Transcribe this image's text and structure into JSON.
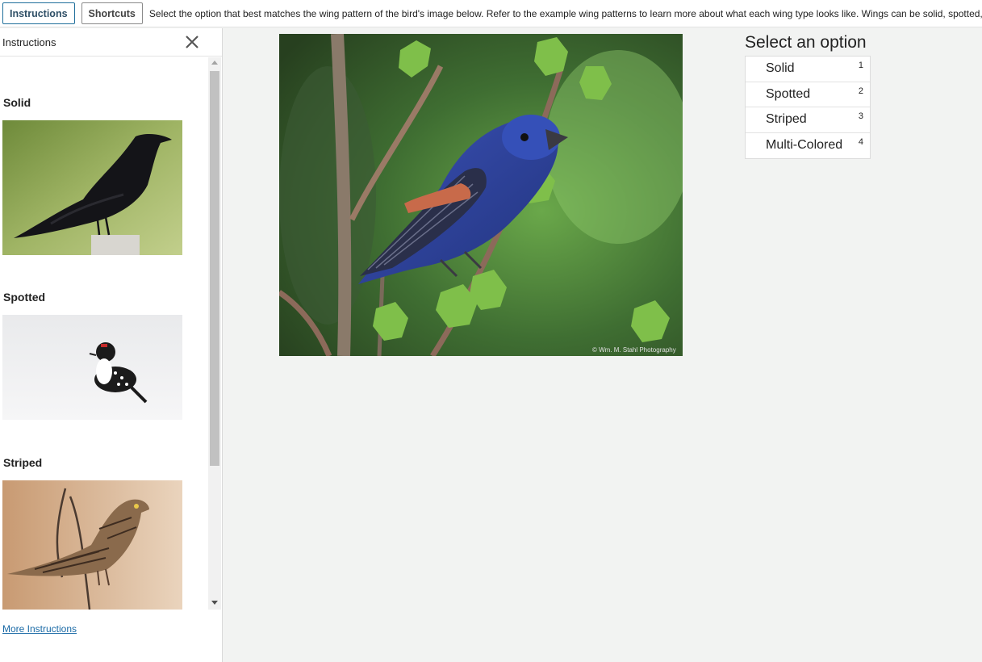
{
  "topbar": {
    "instructions_button": "Instructions",
    "shortcuts_button": "Shortcuts",
    "instruction_text": "Select the option that best matches the wing pattern of the bird's image below. Refer to the example wing patterns to learn more about what each wing type looks like. Wings can be solid, spotted, striped, or multi-colored."
  },
  "sidebar": {
    "title": "Instructions",
    "examples": [
      {
        "label": "Solid"
      },
      {
        "label": "Spotted"
      },
      {
        "label": "Striped"
      }
    ],
    "more_link": "More Instructions"
  },
  "main": {
    "image_credit": "© Wm. M. Stahl Photography"
  },
  "options": {
    "title": "Select an option",
    "items": [
      {
        "label": "Solid",
        "key": "1"
      },
      {
        "label": "Spotted",
        "key": "2"
      },
      {
        "label": "Striped",
        "key": "3"
      },
      {
        "label": "Multi-Colored",
        "key": "4"
      }
    ]
  },
  "colors": {
    "accent": "#1f6f9b",
    "link": "#1a6aa6",
    "background": "#f2f3f2"
  }
}
